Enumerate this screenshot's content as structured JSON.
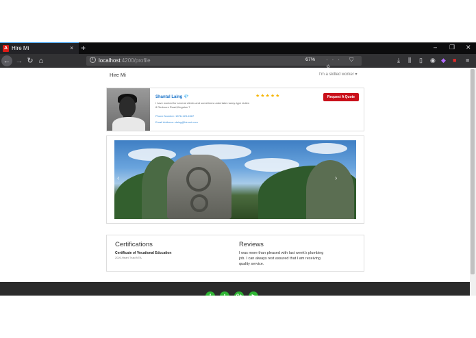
{
  "browser": {
    "tab_title": "Hire Mi",
    "tab_favicon": "A",
    "tab_close": "×",
    "new_tab": "+",
    "window": {
      "minimize": "–",
      "restore": "❐",
      "close": "✕"
    },
    "url_host": "localhost",
    "url_path": ":4200/profile",
    "zoom": "67%",
    "url_actions": "··· ⛉ ☆",
    "nav": {
      "back": "←",
      "forward": "→",
      "reload": "↻",
      "home": "⌂"
    },
    "toolbar_icons": [
      "download-icon",
      "library-icon",
      "sidebar-icon",
      "account-icon",
      "extension-icon",
      "menu-icon"
    ]
  },
  "page": {
    "brand": "Hire Mi",
    "worker_menu": "I'm a skilled worker ▾"
  },
  "profile": {
    "name": "Shantal Laing",
    "verified_icon": "💎",
    "bio": "I have worked for several clients and sometimes undertake nanny-type duties",
    "address": "8 Redmore Road,Kingston 7",
    "phone": "Phone Number: 1876-123-4567",
    "email": "Email Address: slaing@hiremi.com",
    "rating": 5,
    "stars": "★★★★★",
    "quote_button": "Request A Quote"
  },
  "carousel": {
    "prev": "‹",
    "next": "›",
    "slide_count": 3,
    "active_slide": 1
  },
  "certifications": {
    "title": "Certifications",
    "items": [
      {
        "name": "Certificate of Vocational Education",
        "detail": "2020,Heart Trust NTA"
      }
    ]
  },
  "reviews": {
    "title": "Reviews",
    "items": [
      {
        "text": "I was more than pleased with last week's plumbing job. I can always rest assured that I am receiving quality service."
      }
    ]
  },
  "footer": {
    "socials": [
      {
        "name": "facebook-icon",
        "glyph": "f"
      },
      {
        "name": "twitter-icon",
        "glyph": "t"
      },
      {
        "name": "google-plus-icon",
        "glyph": "G+"
      },
      {
        "name": "youtube-icon",
        "glyph": "▶"
      }
    ],
    "social_color": "#2fb634"
  },
  "colors": {
    "accent": "#c9101a",
    "link": "#3a8fd9",
    "star": "#f5b400",
    "browser_dark": "#0c0c0d"
  }
}
